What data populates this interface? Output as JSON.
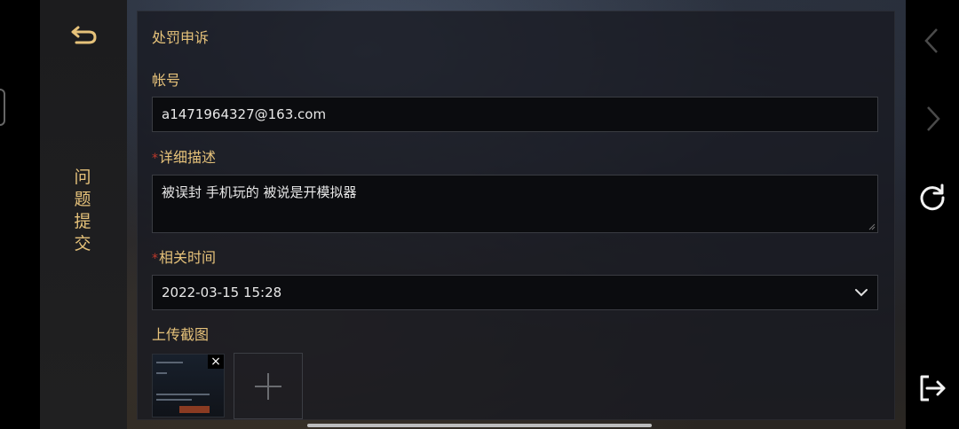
{
  "sidebar": {
    "title_chars": [
      "问",
      "题",
      "提",
      "交"
    ]
  },
  "form": {
    "title": "处罚申诉",
    "account_label": "帐号",
    "account_value": "a1471964327@163.com",
    "required_mark": "*",
    "description_label": "详细描述",
    "description_value": "被误封 手机玩的 被说是开模拟器",
    "time_label": "相关时间",
    "time_value": "2022-03-15 15:28",
    "upload_label": "上传截图",
    "thumb_close": "×"
  },
  "icons": {
    "back": "back-arrow-icon",
    "nav_back": "chevron-left-icon",
    "nav_forward": "chevron-right-icon",
    "refresh": "refresh-icon",
    "exit": "exit-icon",
    "add": "plus-icon",
    "dropdown": "chevron-down-icon"
  },
  "colors": {
    "accent_gold": "#e6c27a",
    "required_red": "#c0392b",
    "field_bg": "#0b0c0f",
    "panel_bg": "#181a21"
  }
}
